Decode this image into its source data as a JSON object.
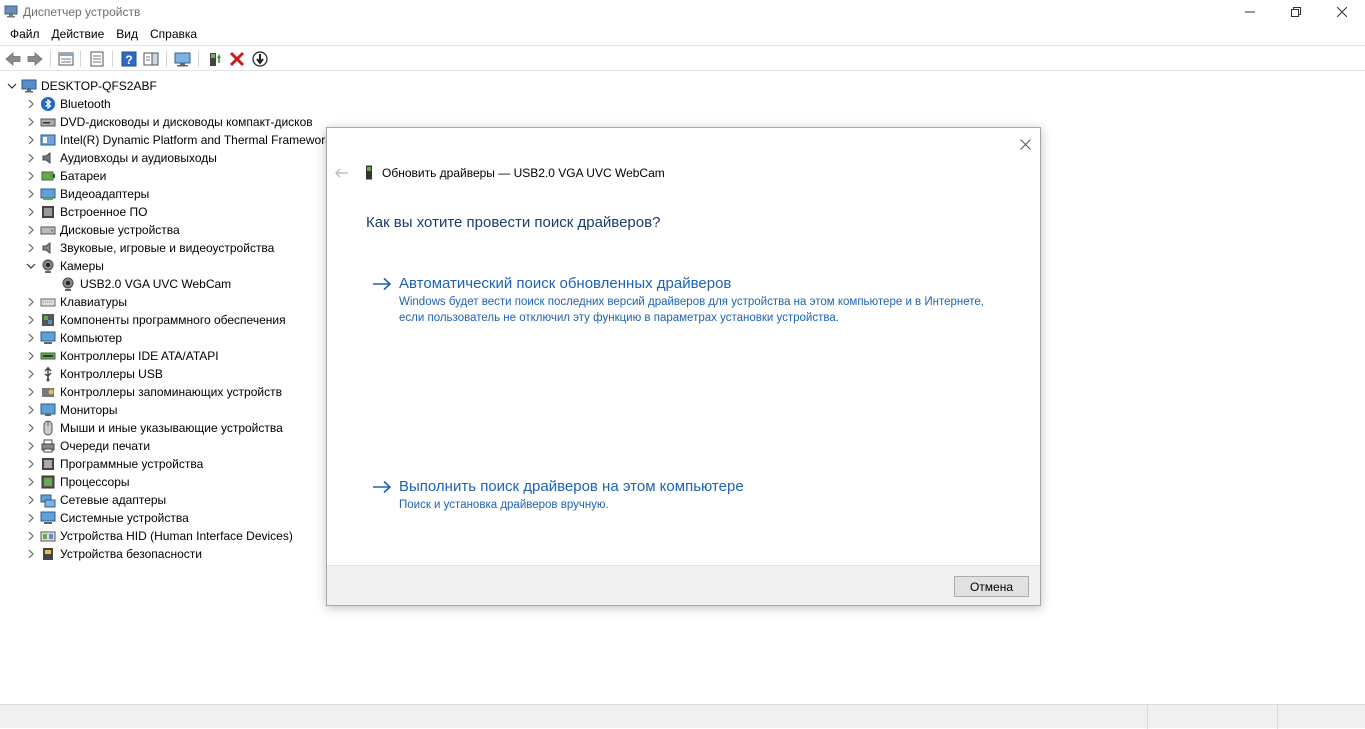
{
  "window": {
    "title": "Диспетчер устройств"
  },
  "menu": {
    "items": [
      "Файл",
      "Действие",
      "Вид",
      "Справка"
    ]
  },
  "toolbar": {
    "buttons": [
      "back-icon",
      "forward-icon",
      "properties-icon",
      "show-hidden-icon",
      "help-icon",
      "action-pane-icon",
      "scan-hardware-icon",
      "update-driver-icon",
      "uninstall-icon",
      "disable-icon"
    ]
  },
  "tree": {
    "root": "DESKTOP-QFS2ABF",
    "items": [
      {
        "label": "Bluetooth",
        "icon": "bluetooth-icon",
        "expanded": false
      },
      {
        "label": "DVD-дисководы и дисководы компакт-дисков",
        "icon": "dvd-drive-icon",
        "expanded": false
      },
      {
        "label": "Intel(R) Dynamic Platform and Thermal Framework",
        "icon": "thermal-framework-icon",
        "expanded": false
      },
      {
        "label": "Аудиовходы и аудиовыходы",
        "icon": "speaker-icon",
        "expanded": false
      },
      {
        "label": "Батареи",
        "icon": "battery-icon",
        "expanded": false
      },
      {
        "label": "Видеоадаптеры",
        "icon": "display-adapter-icon",
        "expanded": false
      },
      {
        "label": "Встроенное ПО",
        "icon": "firmware-icon",
        "expanded": false
      },
      {
        "label": "Дисковые устройства",
        "icon": "disk-drive-icon",
        "expanded": false
      },
      {
        "label": "Звуковые, игровые и видеоустройства",
        "icon": "sound-device-icon",
        "expanded": false
      },
      {
        "label": "Камеры",
        "icon": "camera-icon",
        "expanded": true
      },
      {
        "label": "USB2.0 VGA UVC WebCam",
        "icon": "webcam-icon",
        "child": true
      },
      {
        "label": "Клавиатуры",
        "icon": "keyboard-icon",
        "expanded": false
      },
      {
        "label": "Компоненты программного обеспечения",
        "icon": "software-component-icon",
        "expanded": false
      },
      {
        "label": "Компьютер",
        "icon": "computer-icon",
        "expanded": false
      },
      {
        "label": "Контроллеры IDE ATA/ATAPI",
        "icon": "ide-controller-icon",
        "expanded": false
      },
      {
        "label": "Контроллеры USB",
        "icon": "usb-icon",
        "expanded": false
      },
      {
        "label": "Контроллеры запоминающих устройств",
        "icon": "storage-controller-icon",
        "expanded": false
      },
      {
        "label": "Мониторы",
        "icon": "monitor-icon",
        "expanded": false
      },
      {
        "label": "Мыши и иные указывающие устройства",
        "icon": "mouse-icon",
        "expanded": false
      },
      {
        "label": "Очереди печати",
        "icon": "printer-icon",
        "expanded": false
      },
      {
        "label": "Программные устройства",
        "icon": "software-device-icon",
        "expanded": false
      },
      {
        "label": "Процессоры",
        "icon": "processor-icon",
        "expanded": false
      },
      {
        "label": "Сетевые адаптеры",
        "icon": "network-adapter-icon",
        "expanded": false
      },
      {
        "label": "Системные устройства",
        "icon": "system-device-icon",
        "expanded": false
      },
      {
        "label": "Устройства HID (Human Interface Devices)",
        "icon": "hid-icon",
        "expanded": false
      },
      {
        "label": "Устройства безопасности",
        "icon": "security-device-icon",
        "expanded": false
      }
    ]
  },
  "dialog": {
    "title": "Обновить драйверы — USB2.0 VGA UVC WebCam",
    "heading": "Как вы хотите провести поиск драйверов?",
    "option_auto": {
      "title": "Автоматический поиск обновленных драйверов",
      "description": "Windows будет вести поиск последних версий драйверов для устройства на этом компьютере и в Интернете, если пользователь не отключил эту функцию в параметрах установки устройства."
    },
    "option_manual": {
      "title": "Выполнить поиск драйверов на этом компьютере",
      "description": "Поиск и установка драйверов вручную."
    },
    "cancel_label": "Отмена"
  },
  "colors": {
    "link_blue": "#1d62b6",
    "heading_blue": "#1a3c6e",
    "footer_gray": "#f0f0f0"
  }
}
